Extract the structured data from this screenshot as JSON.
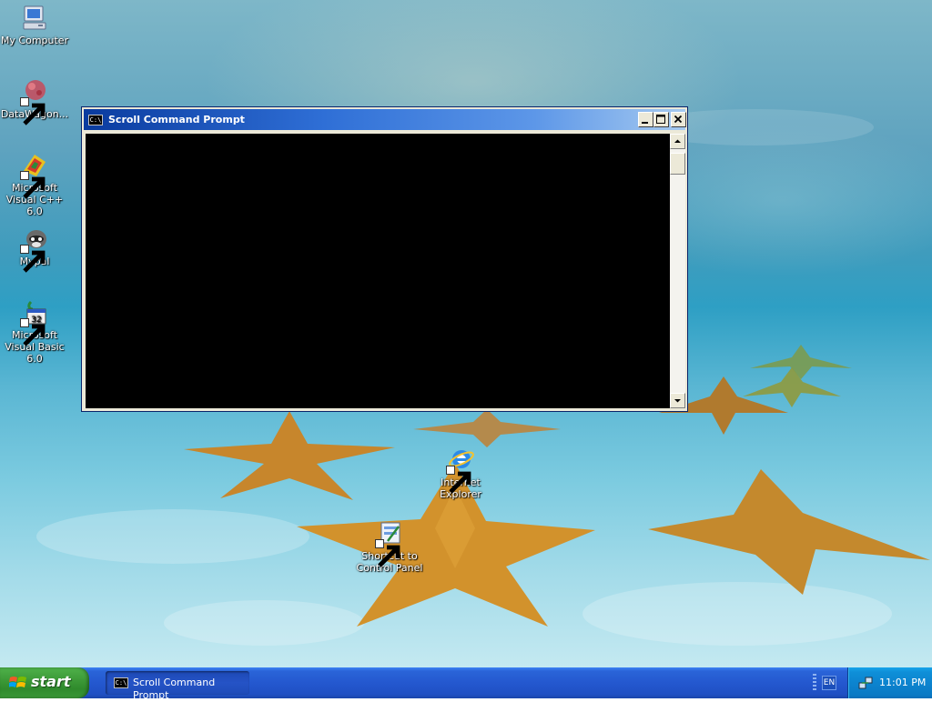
{
  "desktop": {
    "icons": [
      {
        "label": "My Computer",
        "icon": "my-computer-icon"
      },
      {
        "label": "DataWagon...",
        "icon": "datawagon-icon"
      },
      {
        "label": "Microsoft Visual C++ 6.0",
        "icon": "visual-cpp-icon"
      },
      {
        "label": "Mypal",
        "icon": "mypal-icon"
      },
      {
        "label": "Microsoft Visual Basic 6.0",
        "icon": "visual-basic-icon"
      },
      {
        "label": "Internet Explorer",
        "icon": "internet-explorer-icon"
      },
      {
        "label": "Shortcut to Control Panel",
        "icon": "control-panel-icon"
      }
    ]
  },
  "console_window": {
    "title": "Scroll Command Prompt",
    "icon_text": "C:\\"
  },
  "taskbar": {
    "start_label": "start",
    "task_item_label": "Scroll Command Prompt",
    "task_item_icon_text": "C:\\",
    "language": "EN",
    "clock": "11:01 PM"
  },
  "colors": {
    "titlebar_start": "#0a3b9f",
    "titlebar_end": "#a6caf0",
    "taskbar": "#2458cf",
    "start_button": "#3d9a38",
    "tray": "#0c84cf"
  }
}
